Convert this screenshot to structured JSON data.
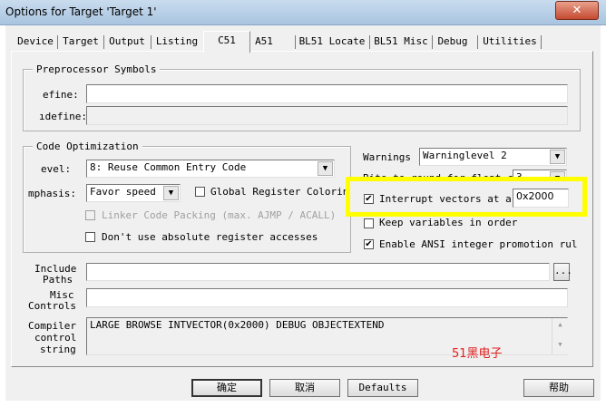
{
  "window": {
    "title": "Options for Target 'Target 1'",
    "close_glyph": "✕"
  },
  "tabs": [
    {
      "label": "Device"
    },
    {
      "label": "Target"
    },
    {
      "label": "Output"
    },
    {
      "label": "Listing"
    },
    {
      "label": "C51"
    },
    {
      "label": "A51"
    },
    {
      "label": "BL51 Locate"
    },
    {
      "label": "BL51 Misc"
    },
    {
      "label": "Debug"
    },
    {
      "label": "Utilities"
    }
  ],
  "preprocessor": {
    "group_label": "Preprocessor Symbols",
    "define_label": "efine:",
    "define_value": "",
    "undefine_label": "ıdefine:",
    "undefine_value": ""
  },
  "code_opt": {
    "group_label": "Code Optimization",
    "level_label": "evel:",
    "level_value": "8: Reuse Common Entry Code",
    "emphasis_label": "mphasis:",
    "emphasis_value": "Favor speed",
    "global_reg_label": "Global Register Coloring",
    "global_reg_checked": false,
    "linker_pack_label": "Linker Code Packing (max. AJMP / ACALL)",
    "linker_pack_checked": false,
    "no_abs_label": "Don't use absolute register accesses",
    "no_abs_checked": false,
    "dropdown_glyph": "▼"
  },
  "right_opts": {
    "warnings_label": "Warnings",
    "warnings_value": "Warninglevel 2",
    "bits_label": "Bits to round for float compare:",
    "bits_value": "3",
    "interrupt_label": "Interrupt vectors at a",
    "interrupt_value": "0x2000",
    "interrupt_checked": true,
    "keep_vars_label": "Keep variables in order",
    "keep_vars_checked": false,
    "ansi_label": "Enable ANSI integer promotion rul",
    "ansi_checked": true,
    "check_glyph": "✔"
  },
  "paths": {
    "include_label_1": "Include",
    "include_label_2": "Paths",
    "include_value": "",
    "browse_label": "...",
    "misc_label_1": "Misc",
    "misc_label_2": "Controls",
    "misc_value": "",
    "compiler_label_1": "Compiler",
    "compiler_label_2": "control",
    "compiler_label_3": "string",
    "compiler_value": "LARGE BROWSE INTVECTOR(0x2000) DEBUG OBJECTEXTEND",
    "scroll_up": "▲",
    "scroll_down": "▼"
  },
  "buttons": {
    "ok": "确定",
    "cancel": "取消",
    "defaults": "Defaults",
    "help": "帮助"
  },
  "watermark": "51黑电子",
  "colors": {
    "highlight": "#ffff00",
    "watermark": "#e02020",
    "titlebar": "#b8d0e8"
  }
}
